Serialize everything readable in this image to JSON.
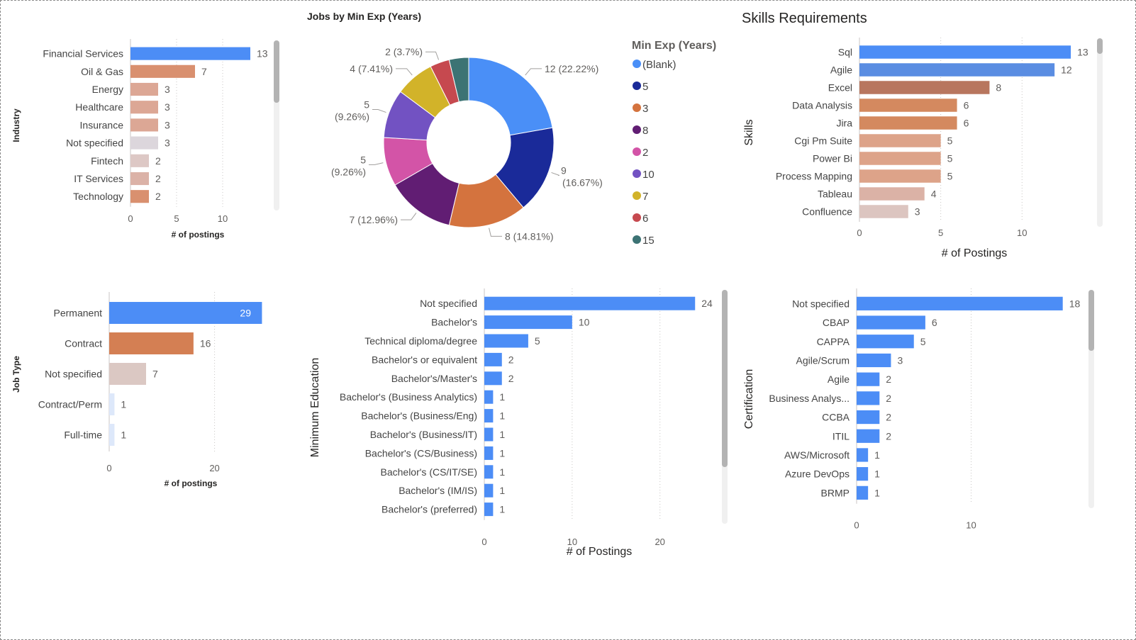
{
  "chart_data": [
    {
      "id": "industry",
      "type": "bar",
      "orientation": "horizontal",
      "ylabel": "Industry",
      "xlabel": "# of postings",
      "xlim": [
        0,
        15
      ],
      "xticks": [
        0,
        5,
        10
      ],
      "grid": true,
      "scrollbar": true,
      "categories": [
        "Financial Services",
        "Oil & Gas",
        "Energy",
        "Healthcare",
        "Insurance",
        "Not specified",
        "Fintech",
        "IT Services",
        "Technology"
      ],
      "values": [
        13,
        7,
        3,
        3,
        3,
        3,
        2,
        2,
        2
      ],
      "colors": [
        "#4c8df6",
        "#d9906f",
        "#dca795",
        "#dca795",
        "#dca795",
        "#dcd6dc",
        "#ddc8c5",
        "#dbb2a7",
        "#d9906f"
      ]
    },
    {
      "id": "min_exp",
      "type": "pie",
      "donut": true,
      "title": "Jobs by Min Exp (Years)",
      "legend_title": "Min Exp (Years)",
      "legend_position": "right",
      "slices": [
        {
          "name": "(Blank)",
          "value": 12,
          "label": "12 (22.22%)",
          "color": "#4a8ff7"
        },
        {
          "name": "5",
          "value": 9,
          "label": "9 (16.67%)",
          "color": "#1a2a99"
        },
        {
          "name": "3",
          "value": 8,
          "label": "8 (14.81%)",
          "color": "#d4733e"
        },
        {
          "name": "8",
          "value": 7,
          "label": "7 (12.96%)",
          "color": "#611d73"
        },
        {
          "name": "2",
          "value": 5,
          "label": "5 (9.26%)",
          "color": "#d354a7"
        },
        {
          "name": "10",
          "value": 5,
          "label": "5 (9.26%)",
          "color": "#7252c2"
        },
        {
          "name": "7",
          "value": 4,
          "label": "4 (7.41%)",
          "color": "#d2b329"
        },
        {
          "name": "6",
          "value": 2,
          "label": "2 (3.7%)",
          "color": "#c6494f"
        },
        {
          "name": "15",
          "value": 2,
          "label": "",
          "color": "#3c7374"
        }
      ]
    },
    {
      "id": "skills",
      "type": "bar",
      "orientation": "horizontal",
      "title": "Skills Requirements",
      "ylabel": "Skills",
      "xlabel": "# of Postings",
      "xlim": [
        0,
        14
      ],
      "xticks": [
        0,
        5,
        10
      ],
      "grid": true,
      "scrollbar": true,
      "categories": [
        "Sql",
        "Agile",
        "Excel",
        "Data Analysis",
        "Jira",
        "Cgi Pm Suite",
        "Power Bi",
        "Process Mapping",
        "Tableau",
        "Confluence"
      ],
      "values": [
        13,
        12,
        8,
        6,
        6,
        5,
        5,
        5,
        4,
        3
      ],
      "colors": [
        "#4c8df6",
        "#5a8de2",
        "#b8765e",
        "#d4895f",
        "#d4895f",
        "#dda389",
        "#dda389",
        "#dda389",
        "#dbb2a6",
        "#dcc5c0"
      ]
    },
    {
      "id": "job_type",
      "type": "bar",
      "orientation": "horizontal",
      "ylabel": "Job Type",
      "xlabel": "# of postings",
      "xlim": [
        0,
        28
      ],
      "xticks": [
        0,
        20
      ],
      "grid": true,
      "categories": [
        "Permanent",
        "Contract",
        "Not specified",
        "Contract/Perm",
        "Full-time"
      ],
      "values": [
        29,
        16,
        7,
        1,
        1
      ],
      "colors": [
        "#4c8df6",
        "#d47f53",
        "#dbc8c3",
        "#dde8fa",
        "#dde8fa"
      ]
    },
    {
      "id": "min_education",
      "type": "bar",
      "orientation": "horizontal",
      "ylabel": "Minimum Education",
      "xlabel": "# of Postings",
      "xlim": [
        0,
        26
      ],
      "xticks": [
        0,
        10,
        20
      ],
      "grid": true,
      "scrollbar": true,
      "categories": [
        "Not specified",
        "Bachelor's",
        "Technical diploma/degree",
        "Bachelor's or equivalent",
        "Bachelor's/Master's",
        "Bachelor's (Business Analytics)",
        "Bachelor's (Business/Eng)",
        "Bachelor's (Business/IT)",
        "Bachelor's (CS/Business)",
        "Bachelor's (CS/IT/SE)",
        "Bachelor's (IM/IS)",
        "Bachelor's (preferred)"
      ],
      "values": [
        24,
        10,
        5,
        2,
        2,
        1,
        1,
        1,
        1,
        1,
        1,
        1
      ],
      "colors": [
        "#4c8df6",
        "#4c8df6",
        "#4c8df6",
        "#4c8df6",
        "#4c8df6",
        "#4c8df6",
        "#4c8df6",
        "#4c8df6",
        "#4c8df6",
        "#4c8df6",
        "#4c8df6",
        "#4c8df6"
      ]
    },
    {
      "id": "certification",
      "type": "bar",
      "orientation": "horizontal",
      "ylabel": "Certification",
      "xlabel": "",
      "xlim": [
        0,
        20
      ],
      "xticks": [
        0,
        10
      ],
      "grid": true,
      "scrollbar": true,
      "categories": [
        "Not specified",
        "CBAP",
        "CAPPA",
        "Agile/Scrum",
        "Agile",
        "Business Analys...",
        "CCBA",
        "ITIL",
        "AWS/Microsoft",
        "Azure DevOps",
        "BRMP"
      ],
      "values": [
        18,
        6,
        5,
        3,
        2,
        2,
        2,
        2,
        1,
        1,
        1
      ],
      "colors": [
        "#4c8df6",
        "#4c8df6",
        "#4c8df6",
        "#4c8df6",
        "#4c8df6",
        "#4c8df6",
        "#4c8df6",
        "#4c8df6",
        "#4c8df6",
        "#4c8df6",
        "#4c8df6"
      ]
    }
  ]
}
